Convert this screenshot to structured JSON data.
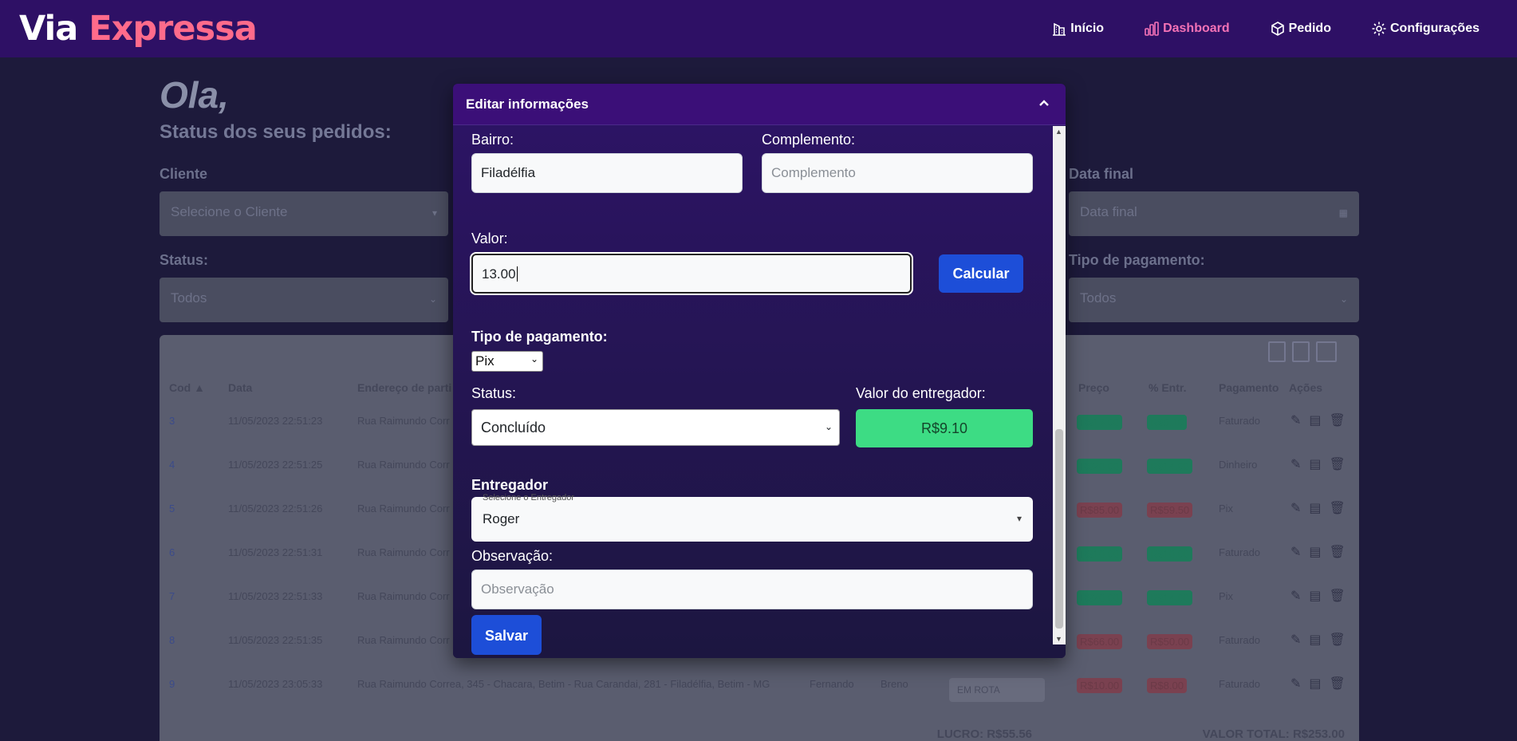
{
  "brand": {
    "part1": "Via",
    "part2": "Expressa"
  },
  "nav": [
    {
      "label": "Início",
      "icon": "building-icon"
    },
    {
      "label": "Dashboard",
      "icon": "bar-chart-icon"
    },
    {
      "label": "Pedido",
      "icon": "box-icon"
    },
    {
      "label": "Configurações",
      "icon": "gear-icon"
    }
  ],
  "background": {
    "greeting": "Ola,",
    "subtitle": "Status dos seus pedidos:",
    "filters": {
      "cliente_label": "Cliente",
      "cliente_value": "Selecione o Cliente",
      "status_label": "Status:",
      "status_value": "Todos",
      "data_final_label": "Data final",
      "data_final_value": "Data final",
      "tipo_pag_label": "Tipo de pagamento:",
      "tipo_pag_value": "Todos"
    },
    "table": {
      "headers": [
        "Cod ▲",
        "Data",
        "Endereço de parti",
        "Preço",
        "% Entr.",
        "Pagamento",
        "Ações"
      ],
      "rows": [
        {
          "cod": "3",
          "date": "11/05/2023 22:51:23",
          "addr": "Rua Raimundo Corr",
          "preco": "R$13.00",
          "entr": "R$9.10",
          "pag": "Faturado",
          "tone": "g"
        },
        {
          "cod": "4",
          "date": "11/05/2023 22:51:25",
          "addr": "Rua Raimundo Corr",
          "preco": "R$20.00",
          "entr": "R$14.00",
          "pag": "Dinheiro",
          "tone": "g"
        },
        {
          "cod": "5",
          "date": "11/05/2023 22:51:26",
          "addr": "Rua Raimundo Corr",
          "preco": "R$85.00",
          "entr": "R$59.50",
          "pag": "Pix",
          "tone": "r"
        },
        {
          "cod": "6",
          "date": "11/05/2023 22:51:31",
          "addr": "Rua Raimundo Corr",
          "preco": "R$10.00",
          "entr": "R$10.00",
          "pag": "Faturado",
          "tone": "g"
        },
        {
          "cod": "7",
          "date": "11/05/2023 22:51:33",
          "addr": "Rua Raimundo Corr",
          "preco": "R$20.00",
          "entr": "R$14.00",
          "pag": "Pix",
          "tone": "g"
        },
        {
          "cod": "8",
          "date": "11/05/2023 22:51:35",
          "addr": "Rua Raimundo Corr",
          "preco": "R$66.00",
          "entr": "R$50.00",
          "pag": "Faturado",
          "tone": "r"
        },
        {
          "cod": "9",
          "date": "11/05/2023 23:05:33",
          "addr": "Rua Raimundo Correa, 345 - Chacara, Betim - Rua Carandai, 281 - Filadélfia, Betim - MG",
          "cliente": "Fernando",
          "entregador": "Breno",
          "status": "EM ROTA",
          "preco": "R$10.00",
          "entr": "R$8.00",
          "pag": "Faturado",
          "tone": "r"
        }
      ],
      "lucro": "LUCRO: R$55.56",
      "valor_total": "VALOR TOTAL: R$253.00"
    }
  },
  "modal": {
    "title": "Editar informações",
    "bairro_label": "Bairro:",
    "bairro_value": "Filadélfia",
    "complemento_label": "Complemento:",
    "complemento_placeholder": "Complemento",
    "valor_label": "Valor:",
    "valor_value": "13.00",
    "calcular_label": "Calcular",
    "tipo_pagamento_label": "Tipo de pagamento:",
    "tipo_pagamento_value": "Pix",
    "status_label": "Status:",
    "status_value": "Concluído",
    "valor_entregador_label": "Valor do entregador:",
    "valor_entregador_value": "R$9.10",
    "entregador_label": "Entregador",
    "entregador_floating": "Selecione o Entregador",
    "entregador_value": "Roger",
    "observacao_label": "Observação:",
    "observacao_placeholder": "Observação",
    "salvar_label": "Salvar"
  }
}
